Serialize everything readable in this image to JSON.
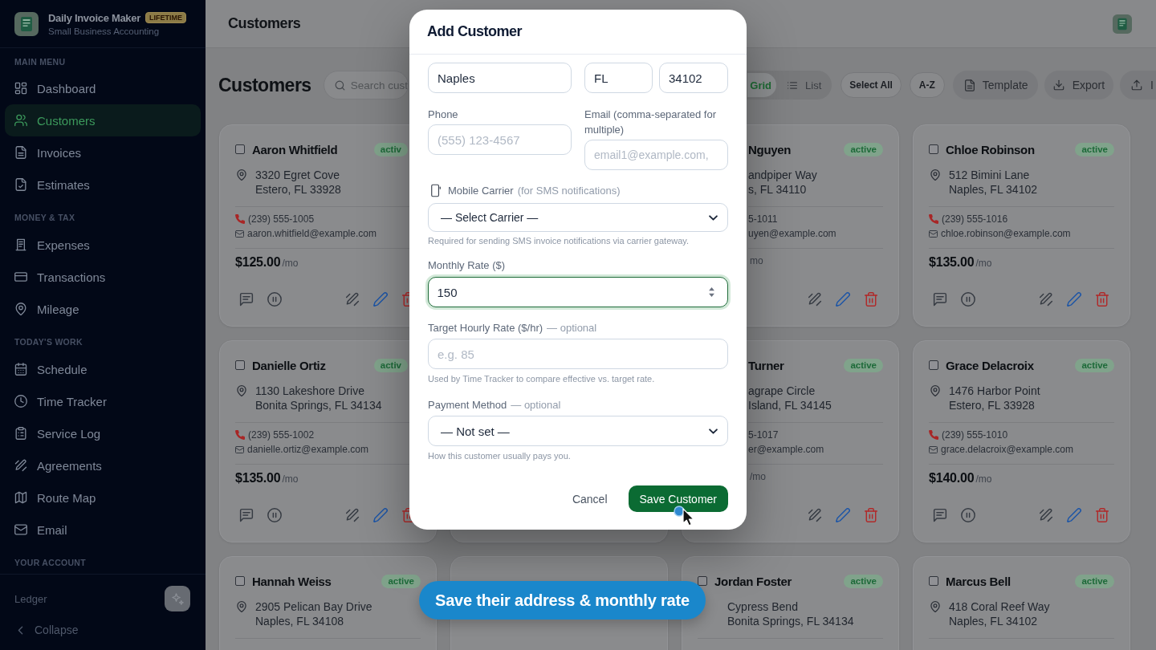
{
  "sidebar": {
    "brand": {
      "name": "Daily Invoice Maker",
      "badge": "LIFETIME",
      "tagline": "Small Business Accounting"
    },
    "sections": [
      {
        "title": "MAIN MENU",
        "items": [
          {
            "label": "Dashboard",
            "selected": false
          },
          {
            "label": "Customers",
            "selected": true
          },
          {
            "label": "Invoices",
            "selected": false
          },
          {
            "label": "Estimates",
            "selected": false
          }
        ]
      },
      {
        "title": "MONEY & TAX",
        "items": [
          {
            "label": "Expenses",
            "selected": false
          },
          {
            "label": "Transactions",
            "selected": false
          },
          {
            "label": "Mileage",
            "selected": false
          }
        ]
      },
      {
        "title": "TODAY'S WORK",
        "items": [
          {
            "label": "Schedule",
            "selected": false
          },
          {
            "label": "Time Tracker",
            "selected": false
          },
          {
            "label": "Service Log",
            "selected": false
          },
          {
            "label": "Agreements",
            "selected": false
          },
          {
            "label": "Route Map",
            "selected": false
          },
          {
            "label": "Email",
            "selected": false
          }
        ]
      },
      {
        "title": "YOUR ACCOUNT"
      }
    ],
    "footer": {
      "label": "Ledger",
      "collapse": "Collapse"
    }
  },
  "header": {
    "title": "Customers"
  },
  "toolbar": {
    "heading": "Customers",
    "search": {
      "placeholder": "Search cust"
    },
    "view_toggle": [
      {
        "label": "Grid",
        "selected": true
      },
      {
        "label": "List",
        "selected": false
      }
    ],
    "buttons": [
      {
        "label": "Select All",
        "kind": "outline"
      },
      {
        "label": "A-Z",
        "kind": "outline"
      },
      {
        "label": "Template",
        "kind": "filled"
      },
      {
        "label": "Export",
        "kind": "filled"
      },
      {
        "label": "I",
        "kind": "filled"
      }
    ]
  },
  "customers": [
    {
      "kind": "cut-right",
      "checked": false,
      "name": "Aaron Whitfield",
      "status": "activ",
      "address": [
        "3320 Egret Cove",
        "Estero, FL 33928"
      ],
      "phone": "(239) 555-1005",
      "email": "aaron.whitfield@example.com",
      "rate": "$125.00",
      "period": "/mo"
    },
    {
      "kind": "cut-left",
      "name": "Nguyen",
      "status": "active",
      "address": [
        "andpiper Way",
        "s, FL 34110"
      ],
      "phone": "5-1011",
      "email": "uyen@example.com",
      "period": "mo"
    },
    {
      "kind": "full",
      "checked": false,
      "name": "Chloe Robinson",
      "status": "active",
      "address": [
        "512 Bimini Lane",
        "Naples, FL 34102"
      ],
      "phone": "(239) 555-1016",
      "email": "chloe.robinson@example.com",
      "rate": "$135.00",
      "period": "/mo"
    },
    {
      "kind": "cut-right",
      "checked": false,
      "name": "Danielle Ortiz",
      "status": "activ",
      "address": [
        "1130 Lakeshore Drive",
        "Bonita Springs, FL 34134"
      ],
      "phone": "(239) 555-1002",
      "email": "danielle.ortiz@example.com",
      "rate": "$135.00",
      "period": "/mo"
    },
    {
      "kind": "covered"
    },
    {
      "kind": "cut-left",
      "name": "Turner",
      "status": "active",
      "address": [
        "agrape Circle",
        "Island, FL 34145"
      ],
      "phone": "5-1017",
      "email": "er@example.com",
      "period": "/mo"
    },
    {
      "kind": "full",
      "checked": false,
      "name": "Grace Delacroix",
      "status": "active",
      "address": [
        "1476 Harbor Point",
        "Estero, FL 33928"
      ],
      "phone": "(239) 555-1010",
      "email": "grace.delacroix@example.com",
      "rate": "$140.00",
      "period": "/mo"
    },
    {
      "kind": "full",
      "checked": false,
      "name": "Hannah Weiss",
      "status": "active",
      "address": [
        "2905 Pelican Bay Drive",
        "Naples, FL 34108"
      ]
    },
    {
      "kind": "covered"
    },
    {
      "kind": "pin-covered",
      "checked": false,
      "name": "Jordan Foster",
      "status": "active",
      "address": [
        "Cypress Bend",
        "Bonita Springs, FL 34134"
      ]
    },
    {
      "kind": "full",
      "checked": false,
      "name": "Marcus Bell",
      "status": "active",
      "address": [
        "418 Coral Reef Way",
        "Naples, FL 34102"
      ]
    }
  ],
  "dialog": {
    "title": "Add Customer",
    "city": {
      "value": "Naples"
    },
    "state": {
      "value": "FL"
    },
    "zip": {
      "value": "34102"
    },
    "phone": {
      "label": "Phone",
      "placeholder": "(555) 123-4567"
    },
    "email": {
      "label": "Email (comma-separated for multiple)",
      "placeholder": "email1@example.com,"
    },
    "carrier": {
      "label": "Mobile Carrier",
      "note": "(for SMS notifications)",
      "value": "— Select Carrier —",
      "hint": "Required for sending SMS invoice notifications via carrier gateway."
    },
    "monthly_rate": {
      "label": "Monthly Rate ($)",
      "value": "150",
      "focused": true
    },
    "hourly_rate": {
      "label": "Target Hourly Rate ($/hr)",
      "note": "— optional",
      "placeholder": "e.g. 85",
      "hint": "Used by Time Tracker to compare effective vs. target rate."
    },
    "payment_method": {
      "label": "Payment Method",
      "note": "— optional",
      "value": "— Not set —",
      "hint": "How this customer usually pays you."
    },
    "buttons": [
      {
        "label": "Cancel",
        "kind": "text"
      },
      {
        "label": "Save Customer",
        "kind": "primary"
      }
    ]
  },
  "tip": {
    "text": "Save their address & monthly rate"
  }
}
